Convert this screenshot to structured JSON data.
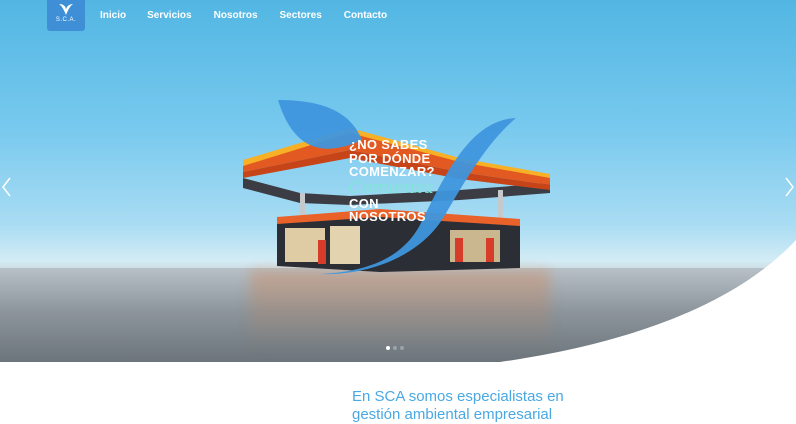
{
  "logo": {
    "text": "S.C.A.",
    "color": "#3f8fd6"
  },
  "nav": {
    "items": [
      "Inicio",
      "Servicios",
      "Nosotros",
      "Sectores",
      "Contacto"
    ]
  },
  "hero": {
    "headline": {
      "line1": "¿NO SABES",
      "line2": "POR DÓNDE",
      "line3": "COMENZAR?",
      "script": "Comienza",
      "line4": "CON",
      "line5": "NOSOTROS"
    },
    "slides": {
      "count": 3,
      "active": 1
    },
    "accent_color": "#3f96dd",
    "script_color": "#7fe6d7",
    "icons": {
      "prev": "chevron-left-icon",
      "next": "chevron-right-icon"
    }
  },
  "intro": {
    "line1": "En SCA somos especialistas en",
    "line2": "gestión ambiental empresarial",
    "color": "#4aa8e4"
  }
}
